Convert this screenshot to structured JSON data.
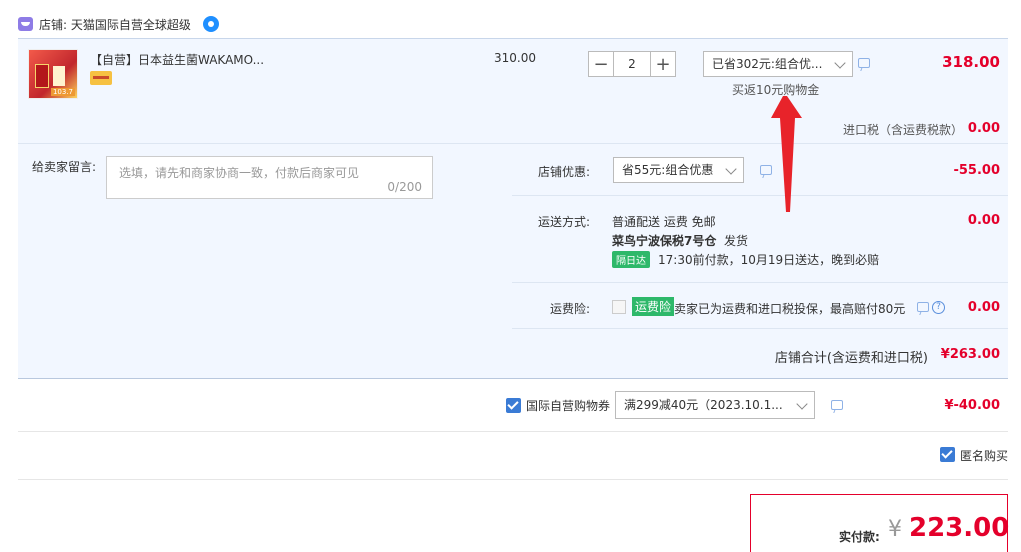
{
  "shop": {
    "name": "店铺: 天猫国际自营全球超级"
  },
  "item": {
    "title": "【自营】日本益生菌WAKAMO...",
    "thumb_badge": "103.7",
    "unit_price": "310.00",
    "quantity": "2",
    "minus": "−",
    "plus": "+",
    "promo_selected": "已省302元:组合优...",
    "rebate": "买返10元购物金",
    "total": "318.00",
    "tax_label": "进口税（含运费税款）",
    "tax_value": "0.00"
  },
  "message": {
    "label": "给卖家留言:",
    "placeholder": "选填，请先和商家协商一致，付款后商家可见",
    "count": "0/200"
  },
  "shop_promo": {
    "label": "店铺优惠:",
    "selected": "省55元:组合优惠",
    "value": "-55.00"
  },
  "shipping": {
    "label": "运送方式:",
    "line1": "普通配送 运费 免邮",
    "warehouse": "菜鸟宁波保税7号仓",
    "dispatch": "发货",
    "nextday_badge": "隔日达",
    "delivery": "17:30前付款，10月19日送达，晚到必赔",
    "value": "0.00"
  },
  "insurance": {
    "label": "运费险:",
    "tag": "运费险",
    "text": "卖家已为运费和进口税投保，最高赔付80元",
    "value": "0.00"
  },
  "shop_total": {
    "label": "店铺合计(含运费和进口税)",
    "value": "¥263.00"
  },
  "coupon": {
    "label": "国际自营购物券",
    "selected": "满299减40元（2023.10.1...",
    "value": "¥-40.00"
  },
  "anonymous": {
    "label": "匿名购买"
  },
  "payment": {
    "label": "实付款:",
    "currency": "¥",
    "amount": "223.00"
  },
  "colors": {
    "price_red": "#e4002b",
    "panel_bg": "#f2f7ff",
    "accent_blue": "#3a7bd5",
    "tag_green": "#2eb86a"
  },
  "icons": [
    "shop-icon",
    "wangwang-icon",
    "chat-icon",
    "chevron-down-icon",
    "help-icon",
    "checkbox-icon",
    "red-arrow-annotation"
  ]
}
